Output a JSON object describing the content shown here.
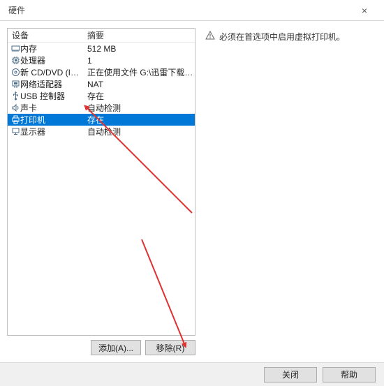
{
  "title": "硬件",
  "listHeader": {
    "device": "设备",
    "summary": "摘要"
  },
  "devices": [
    {
      "icon": "memory-icon",
      "label": "内存",
      "summary": "512 MB"
    },
    {
      "icon": "cpu-icon",
      "label": "处理器",
      "summary": "1"
    },
    {
      "icon": "cd-icon",
      "label": "新 CD/DVD (IDE)",
      "summary": "正在使用文件 G:\\迅雷下载\\kali-l..."
    },
    {
      "icon": "network-icon",
      "label": "网络适配器",
      "summary": "NAT"
    },
    {
      "icon": "usb-icon",
      "label": "USB 控制器",
      "summary": "存在"
    },
    {
      "icon": "sound-icon",
      "label": "声卡",
      "summary": "自动检测"
    },
    {
      "icon": "printer-icon",
      "label": "打印机",
      "summary": "存在"
    },
    {
      "icon": "display-icon",
      "label": "显示器",
      "summary": "自动检测"
    }
  ],
  "selectedIndex": 6,
  "buttons": {
    "add": "添加(A)...",
    "remove": "移除(R)"
  },
  "infoText": "必须在首选项中启用虚拟打印机。",
  "bottom": {
    "close": "关闭",
    "help": "帮助"
  }
}
